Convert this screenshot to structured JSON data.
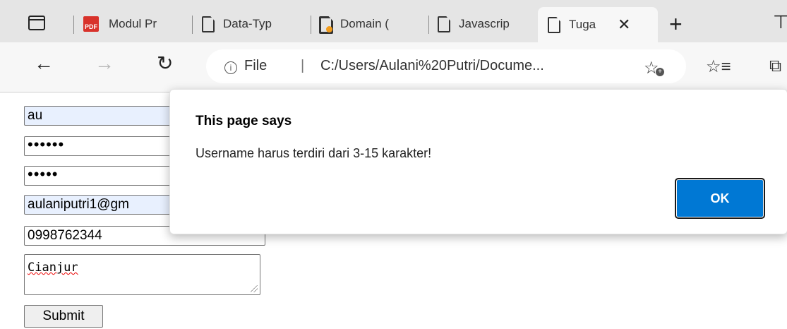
{
  "browser": {
    "tabs": [
      {
        "label": "Modul Pr",
        "icon": "pdf-icon"
      },
      {
        "label": "Data-Typ",
        "icon": "document-icon"
      },
      {
        "label": "Domain (",
        "icon": "document-icon"
      },
      {
        "label": "Javascrip",
        "icon": "document-icon"
      },
      {
        "label": "Tuga",
        "icon": "document-icon",
        "active": true
      }
    ],
    "pdf_badge": "PDF",
    "close_symbol": "✕",
    "new_tab_symbol": "+",
    "address": {
      "info_symbol": "i",
      "scheme_label": "File",
      "separator": "|",
      "url": "C:/Users/Aulani%20Putri/Docume..."
    }
  },
  "form": {
    "username": "au",
    "password_mask": "••••••",
    "confirm_mask": "•••••",
    "email": "aulaniputri1@gm",
    "phone": "0998762344",
    "address": "Cianjur",
    "submit_label": "Submit"
  },
  "dialog": {
    "title": "This page says",
    "message": "Username harus terdiri dari 3-15 karakter!",
    "ok_label": "OK"
  },
  "colors": {
    "accent": "#0078d4",
    "autofill": "#e8f0fe",
    "pdf_red": "#d8322b",
    "notify_orange": "#f29c1c"
  }
}
